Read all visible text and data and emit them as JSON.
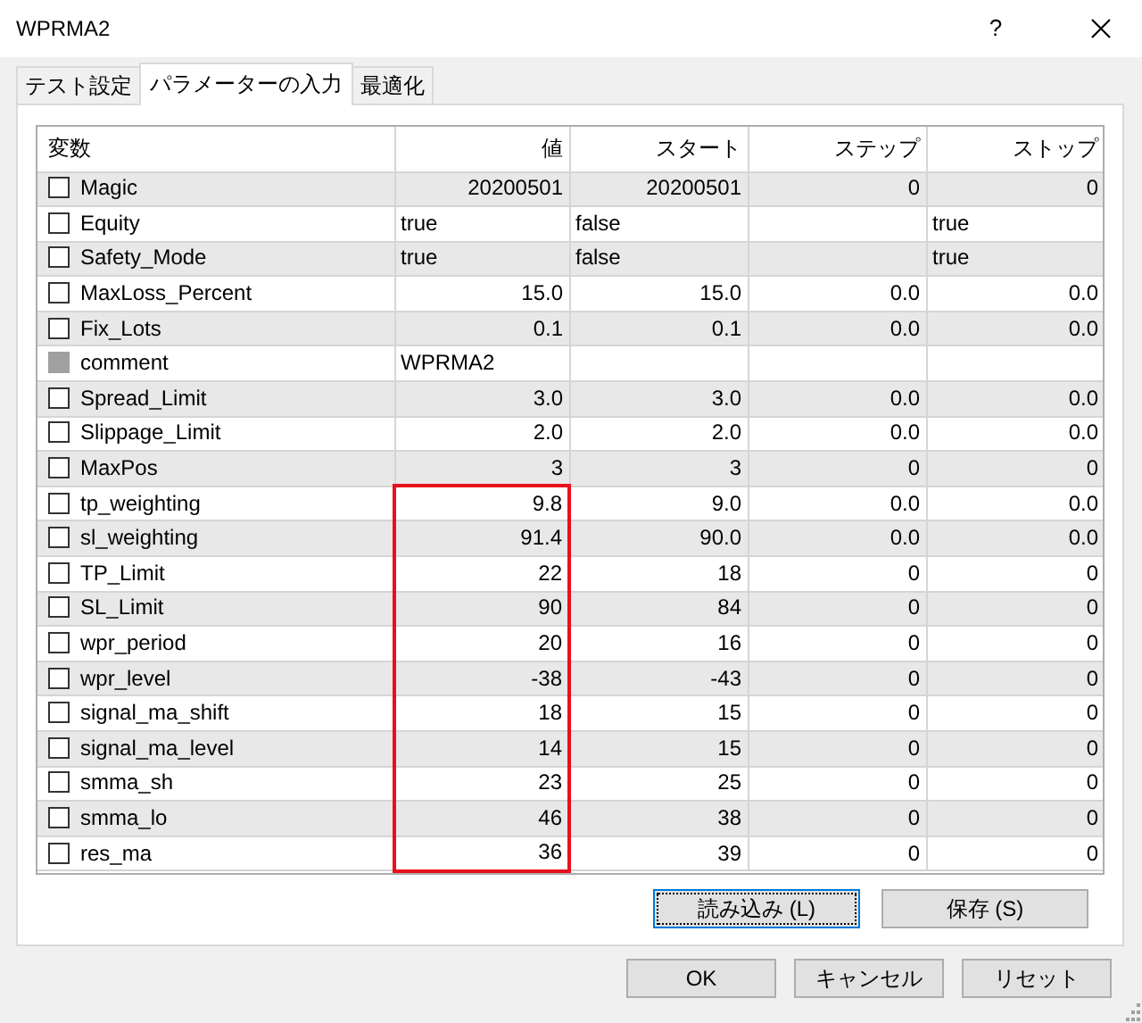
{
  "window": {
    "title": "WPRMA2",
    "help": "?"
  },
  "tabs": [
    {
      "label": "テスト設定",
      "selected": false
    },
    {
      "label": "パラメーターの入力",
      "selected": true
    },
    {
      "label": "最適化",
      "selected": false
    }
  ],
  "table": {
    "columns": [
      "変数",
      "値",
      "スタート",
      "ステップ",
      "ストップ"
    ],
    "rows": [
      {
        "name": "Magic",
        "kind": "number",
        "checked": false,
        "disabled": false,
        "highlighted": false,
        "value": "20200501",
        "start": "20200501",
        "step": "0",
        "stop": "0"
      },
      {
        "name": "Equity",
        "kind": "bool",
        "checked": false,
        "disabled": false,
        "highlighted": false,
        "value": "true",
        "start": "false",
        "stop": "true"
      },
      {
        "name": "Safety_Mode",
        "kind": "bool",
        "checked": false,
        "disabled": false,
        "highlighted": false,
        "value": "true",
        "start": "false",
        "stop": "true"
      },
      {
        "name": "MaxLoss_Percent",
        "kind": "number",
        "checked": false,
        "disabled": false,
        "highlighted": false,
        "value": "15.0",
        "start": "15.0",
        "step": "0.0",
        "stop": "0.0"
      },
      {
        "name": "Fix_Lots",
        "kind": "number",
        "checked": false,
        "disabled": false,
        "highlighted": false,
        "value": "0.1",
        "start": "0.1",
        "step": "0.0",
        "stop": "0.0"
      },
      {
        "name": "comment",
        "kind": "text",
        "checked": false,
        "disabled": true,
        "highlighted": false,
        "value": "WPRMA2"
      },
      {
        "name": "Spread_Limit",
        "kind": "number",
        "checked": false,
        "disabled": false,
        "highlighted": false,
        "value": "3.0",
        "start": "3.0",
        "step": "0.0",
        "stop": "0.0"
      },
      {
        "name": "Slippage_Limit",
        "kind": "number",
        "checked": false,
        "disabled": false,
        "highlighted": false,
        "value": "2.0",
        "start": "2.0",
        "step": "0.0",
        "stop": "0.0"
      },
      {
        "name": "MaxPos",
        "kind": "number",
        "checked": false,
        "disabled": false,
        "highlighted": false,
        "value": "3",
        "start": "3",
        "step": "0",
        "stop": "0"
      },
      {
        "name": "tp_weighting",
        "kind": "number",
        "checked": false,
        "disabled": false,
        "highlighted": true,
        "value": "9.8",
        "start": "9.0",
        "step": "0.0",
        "stop": "0.0"
      },
      {
        "name": "sl_weighting",
        "kind": "number",
        "checked": false,
        "disabled": false,
        "highlighted": true,
        "value": "91.4",
        "start": "90.0",
        "step": "0.0",
        "stop": "0.0"
      },
      {
        "name": "TP_Limit",
        "kind": "number",
        "checked": false,
        "disabled": false,
        "highlighted": true,
        "value": "22",
        "start": "18",
        "step": "0",
        "stop": "0"
      },
      {
        "name": "SL_Limit",
        "kind": "number",
        "checked": false,
        "disabled": false,
        "highlighted": true,
        "value": "90",
        "start": "84",
        "step": "0",
        "stop": "0"
      },
      {
        "name": "wpr_period",
        "kind": "number",
        "checked": false,
        "disabled": false,
        "highlighted": true,
        "value": "20",
        "start": "16",
        "step": "0",
        "stop": "0"
      },
      {
        "name": "wpr_level",
        "kind": "number",
        "checked": false,
        "disabled": false,
        "highlighted": true,
        "value": "-38",
        "start": "-43",
        "step": "0",
        "stop": "0"
      },
      {
        "name": "signal_ma_shift",
        "kind": "number",
        "checked": false,
        "disabled": false,
        "highlighted": true,
        "value": "18",
        "start": "15",
        "step": "0",
        "stop": "0"
      },
      {
        "name": "signal_ma_level",
        "kind": "number",
        "checked": false,
        "disabled": false,
        "highlighted": true,
        "value": "14",
        "start": "15",
        "step": "0",
        "stop": "0"
      },
      {
        "name": "smma_sh",
        "kind": "number",
        "checked": false,
        "disabled": false,
        "highlighted": true,
        "value": "23",
        "start": "25",
        "step": "0",
        "stop": "0"
      },
      {
        "name": "smma_lo",
        "kind": "number",
        "checked": false,
        "disabled": false,
        "highlighted": true,
        "value": "46",
        "start": "38",
        "step": "0",
        "stop": "0"
      },
      {
        "name": "res_ma",
        "kind": "number",
        "checked": false,
        "disabled": false,
        "highlighted": true,
        "value": "36",
        "start": "39",
        "step": "0",
        "stop": "0"
      }
    ]
  },
  "panel_buttons": [
    {
      "label": "読み込み (L)",
      "focused": true
    },
    {
      "label": "保存 (S)",
      "focused": false
    }
  ],
  "buttons": [
    "OK",
    "キャンセル",
    "リセット"
  ]
}
